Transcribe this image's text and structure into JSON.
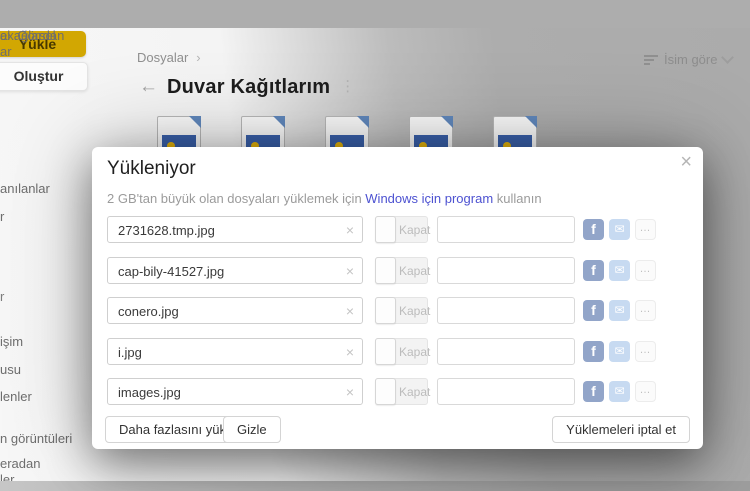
{
  "colors": {
    "accent_yellow": "#d2a702",
    "link_blue": "#4d52d1",
    "facebook_blue": "#92a5c9",
    "mail_blue": "#c7daf1",
    "thumb_blue": "#3a61ab",
    "thumb_fold_blue": "#6188bd",
    "thumb_spot_yellow": "#e7b50c"
  },
  "sidebar": {
    "upload_button": "Yükle",
    "create_button": "Oluştur",
    "items": [
      {
        "label": "anılanlar",
        "selected": false
      },
      {
        "label": "r",
        "selected": true
      },
      {
        "label": "r",
        "selected": false
      },
      {
        "label": "işim",
        "selected": false
      },
      {
        "label": "usu",
        "selected": false
      },
      {
        "label": "lenler",
        "selected": false
      },
      {
        "label": "n görüntüleri",
        "selected": false
      },
      {
        "label": "eradan\nler",
        "selected": false
      },
      {
        "label": "ex.Görsel",
        "selected": false
      },
      {
        "label": "al ağlardan\nar",
        "selected": false
      }
    ]
  },
  "content": {
    "breadcrumb": "Dosyalar",
    "breadcrumb_chevron": "›",
    "sort_label": "İsim göre",
    "back_icon": "←",
    "title": "Duvar Kağıtlarım",
    "kebab_icon": "⋮",
    "thumbnails": [
      {
        "kind": "image-file"
      },
      {
        "kind": "image-file"
      },
      {
        "kind": "image-file"
      },
      {
        "kind": "image-file"
      },
      {
        "kind": "image-file"
      }
    ]
  },
  "modal": {
    "title": "Yükleniyor",
    "close_icon": "×",
    "note": {
      "prefix": "2 GB'tan büyük olan dosyaları yüklemek için ",
      "link": "Windows için program",
      "suffix": " kullanın"
    },
    "rows": [
      {
        "filename": "2731628.tmp.jpg"
      },
      {
        "filename": "cap-bily-41527.jpg"
      },
      {
        "filename": "conero.jpg"
      },
      {
        "filename": "i.jpg"
      },
      {
        "filename": "images.jpg"
      }
    ],
    "row_controls": {
      "clear_icon": "×",
      "toggle_label": "Kapat",
      "facebook_glyph": "f",
      "mail_glyph": "✉",
      "more_glyph": "…"
    },
    "buttons": {
      "upload_more": "Daha fazlasını yükle",
      "hide": "Gizle",
      "cancel_all": "Yüklemeleri iptal et"
    }
  }
}
